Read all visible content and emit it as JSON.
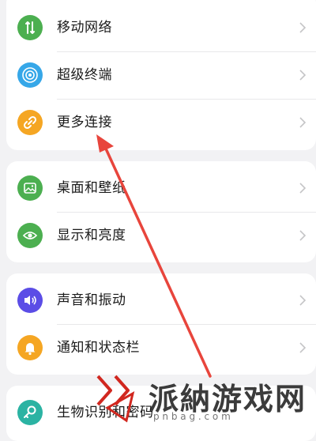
{
  "settings": {
    "items": [
      {
        "label": "移动网络",
        "icon": "mobile-network-icon",
        "color": "#4caf50"
      },
      {
        "label": "超级终端",
        "icon": "super-device-icon",
        "color": "#36a7e8"
      },
      {
        "label": "更多连接",
        "icon": "link-icon",
        "color": "#f5a623"
      },
      {
        "label": "桌面和壁纸",
        "icon": "wallpaper-icon",
        "color": "#4caf50"
      },
      {
        "label": "显示和亮度",
        "icon": "eye-icon",
        "color": "#4caf50"
      },
      {
        "label": "声音和振动",
        "icon": "speaker-icon",
        "color": "#5b4de6"
      },
      {
        "label": "通知和状态栏",
        "icon": "bell-icon",
        "color": "#f5a623"
      },
      {
        "label": "生物识别和密码",
        "icon": "key-icon",
        "color": "#2bb3a3"
      }
    ]
  },
  "watermark": {
    "title": "派納游戏网",
    "url": "p n b a g . c o m",
    "color": "#d1271f"
  },
  "annotation_arrow": {
    "color": "#e8453c"
  }
}
